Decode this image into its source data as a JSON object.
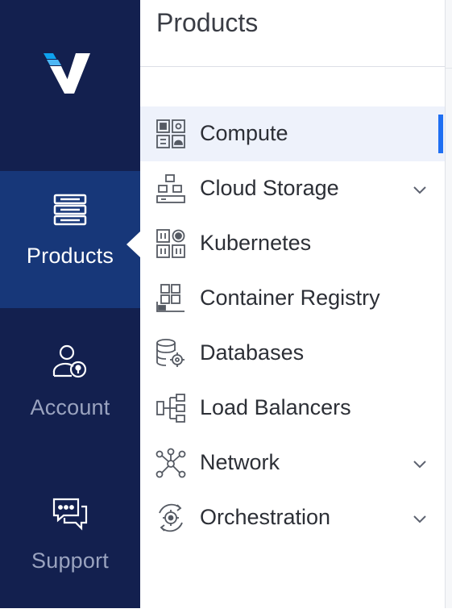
{
  "colors": {
    "rail_bg": "#13204f",
    "rail_active_bg": "#173779",
    "rail_label": "#9aa3bf",
    "accent": "#1f6ff2",
    "active_item_bg": "#eef2fb"
  },
  "rail": {
    "logo_icon": "vultr-logo-icon",
    "items": [
      {
        "label": "Products",
        "icon": "server-stack-icon",
        "active": true
      },
      {
        "label": "Account",
        "icon": "user-lock-icon",
        "active": false
      },
      {
        "label": "Support",
        "icon": "chat-bubbles-icon",
        "active": false
      }
    ]
  },
  "panel": {
    "title": "Products",
    "items": [
      {
        "label": "Compute",
        "icon": "compute-grid-icon",
        "active": true,
        "expandable": false
      },
      {
        "label": "Cloud Storage",
        "icon": "cloud-storage-icon",
        "active": false,
        "expandable": true
      },
      {
        "label": "Kubernetes",
        "icon": "kubernetes-icon",
        "active": false,
        "expandable": false
      },
      {
        "label": "Container Registry",
        "icon": "container-registry-icon",
        "active": false,
        "expandable": false
      },
      {
        "label": "Databases",
        "icon": "database-gear-icon",
        "active": false,
        "expandable": false
      },
      {
        "label": "Load Balancers",
        "icon": "load-balancer-icon",
        "active": false,
        "expandable": false
      },
      {
        "label": "Network",
        "icon": "network-nodes-icon",
        "active": false,
        "expandable": true
      },
      {
        "label": "Orchestration",
        "icon": "orchestration-gear-icon",
        "active": false,
        "expandable": true
      }
    ]
  }
}
